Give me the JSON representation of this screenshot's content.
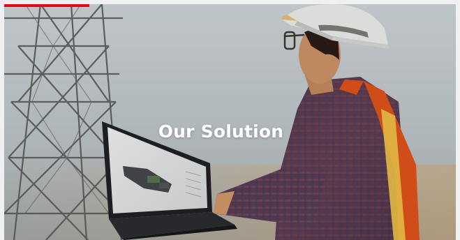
{
  "hero": {
    "title": "Our Solution",
    "accent_color": "#e30a17"
  }
}
